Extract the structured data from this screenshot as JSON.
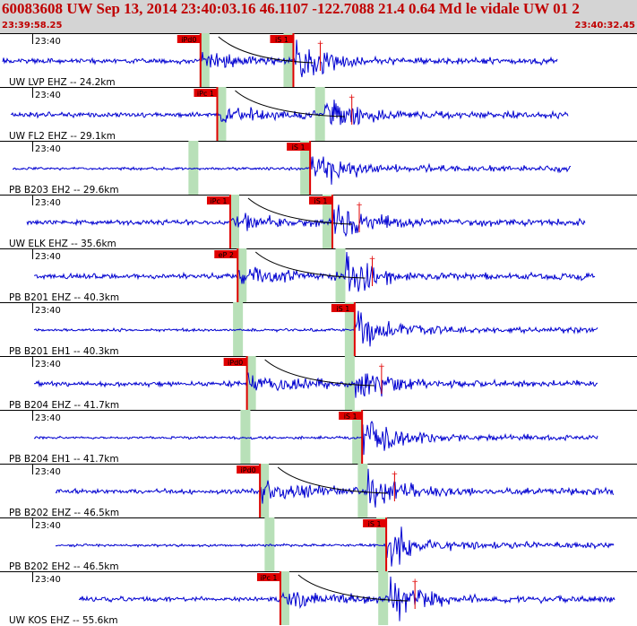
{
  "header": {
    "title": "60083608 UW Sep 13, 2014 23:40:03.16   46.1107 -122.7088 21.4 0.64 Md le vidale UW 01   2",
    "start_time": "23:39:58.25",
    "end_time": "23:40:32.45"
  },
  "colors": {
    "header_bg": "#d4d4d4",
    "header_text": "#c00000",
    "trace": "#0000d0",
    "pick": "#e00000",
    "window": "#b8e0b8",
    "moveout": "#000000"
  },
  "chart_data": {
    "type": "seismogram",
    "time_range": [
      "23:39:58.25",
      "23:40:32.45"
    ],
    "traces": [
      {
        "time_label": "23:40",
        "label": "UW LVP EHZ -- 24.2km",
        "picks": [
          {
            "label": "iPd0",
            "t": 10.7
          },
          {
            "label": "iS 1",
            "t": 15.7
          }
        ],
        "amplitude_marker": true
      },
      {
        "label": "UW FL2 EHZ -- 29.1km",
        "time_label": "23:40",
        "picks": [
          {
            "label": "iPc 1",
            "t": 11.6
          }
        ],
        "amplitude_marker": true
      },
      {
        "label": "PB B203 EH2 -- 29.6km",
        "time_label": "23:40",
        "picks": [
          {
            "label": "iS 1",
            "t": 16.6
          }
        ],
        "amplitude_marker": false
      },
      {
        "label": "UW ELK EHZ -- 35.6km",
        "time_label": "23:40",
        "picks": [
          {
            "label": "iPc 1",
            "t": 12.3
          },
          {
            "label": "iS 1",
            "t": 17.8
          }
        ],
        "amplitude_marker": true
      },
      {
        "label": "PB B201 EHZ -- 40.3km",
        "time_label": "23:40",
        "picks": [
          {
            "label": "eP 2",
            "t": 12.7
          }
        ],
        "amplitude_marker": true
      },
      {
        "label": "PB B201 EH1 -- 40.3km",
        "time_label": "23:40",
        "picks": [
          {
            "label": "iS 1",
            "t": 19.0
          }
        ],
        "amplitude_marker": false
      },
      {
        "label": "PB B204 EHZ -- 41.7km",
        "time_label": "23:40",
        "picks": [
          {
            "label": "iPd0",
            "t": 13.2
          }
        ],
        "amplitude_marker": true
      },
      {
        "label": "PB B204 EH1 -- 41.7km",
        "time_label": "23:40",
        "picks": [
          {
            "label": "iS 1",
            "t": 19.4
          }
        ],
        "amplitude_marker": false
      },
      {
        "label": "PB B202 EHZ -- 46.5km",
        "time_label": "23:40",
        "picks": [
          {
            "label": "iPd0",
            "t": 13.9
          }
        ],
        "amplitude_marker": true
      },
      {
        "label": "PB B202 EH2 -- 46.5km",
        "time_label": "23:40",
        "picks": [
          {
            "label": "iS 1",
            "t": 20.7
          }
        ],
        "amplitude_marker": false
      },
      {
        "label": "UW KOS EHZ -- 55.6km",
        "time_label": "23:40",
        "picks": [
          {
            "label": "iPc 1",
            "t": 15.0
          }
        ],
        "amplitude_marker": true
      }
    ]
  }
}
